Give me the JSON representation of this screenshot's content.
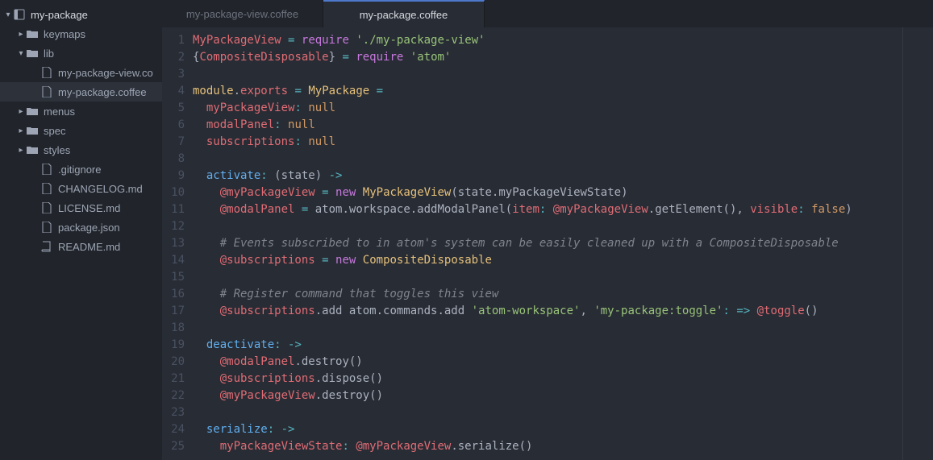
{
  "sidebar": {
    "root": "my-package",
    "items": [
      {
        "kind": "folder",
        "name": "keymaps",
        "expanded": false,
        "depth": 1
      },
      {
        "kind": "folder",
        "name": "lib",
        "expanded": true,
        "depth": 1
      },
      {
        "kind": "file",
        "name": "my-package-view.co",
        "depth": 2,
        "icon": "file"
      },
      {
        "kind": "file",
        "name": "my-package.coffee",
        "depth": 2,
        "icon": "file",
        "selected": true
      },
      {
        "kind": "folder",
        "name": "menus",
        "expanded": false,
        "depth": 1
      },
      {
        "kind": "folder",
        "name": "spec",
        "expanded": false,
        "depth": 1
      },
      {
        "kind": "folder",
        "name": "styles",
        "expanded": false,
        "depth": 1
      },
      {
        "kind": "file",
        "name": ".gitignore",
        "depth": 2,
        "icon": "file"
      },
      {
        "kind": "file",
        "name": "CHANGELOG.md",
        "depth": 2,
        "icon": "file"
      },
      {
        "kind": "file",
        "name": "LICENSE.md",
        "depth": 2,
        "icon": "file"
      },
      {
        "kind": "file",
        "name": "package.json",
        "depth": 2,
        "icon": "file"
      },
      {
        "kind": "file",
        "name": "README.md",
        "depth": 2,
        "icon": "book"
      }
    ]
  },
  "tabs": [
    {
      "label": "my-package-view.coffee",
      "active": false
    },
    {
      "label": "my-package.coffee",
      "active": true
    }
  ],
  "code_lines": [
    [
      {
        "t": "MyPackageView",
        "c": "c-red"
      },
      {
        "t": " ",
        "c": "c-def"
      },
      {
        "t": "=",
        "c": "c-cyan"
      },
      {
        "t": " ",
        "c": "c-def"
      },
      {
        "t": "require",
        "c": "c-purple"
      },
      {
        "t": " ",
        "c": "c-def"
      },
      {
        "t": "'./my-package-view'",
        "c": "c-green"
      }
    ],
    [
      {
        "t": "{",
        "c": "c-def"
      },
      {
        "t": "CompositeDisposable",
        "c": "c-red"
      },
      {
        "t": "} ",
        "c": "c-def"
      },
      {
        "t": "=",
        "c": "c-cyan"
      },
      {
        "t": " ",
        "c": "c-def"
      },
      {
        "t": "require",
        "c": "c-purple"
      },
      {
        "t": " ",
        "c": "c-def"
      },
      {
        "t": "'atom'",
        "c": "c-green"
      }
    ],
    [],
    [
      {
        "t": "module",
        "c": "c-yellow"
      },
      {
        "t": ".",
        "c": "c-def"
      },
      {
        "t": "exports",
        "c": "c-red"
      },
      {
        "t": " ",
        "c": "c-def"
      },
      {
        "t": "=",
        "c": "c-cyan"
      },
      {
        "t": " ",
        "c": "c-def"
      },
      {
        "t": "MyPackage",
        "c": "c-yellow"
      },
      {
        "t": " ",
        "c": "c-def"
      },
      {
        "t": "=",
        "c": "c-cyan"
      }
    ],
    [
      {
        "t": "  ",
        "c": "c-def"
      },
      {
        "t": "myPackageView",
        "c": "c-red"
      },
      {
        "t": ":",
        "c": "c-cyan"
      },
      {
        "t": " ",
        "c": "c-def"
      },
      {
        "t": "null",
        "c": "c-orange"
      }
    ],
    [
      {
        "t": "  ",
        "c": "c-def"
      },
      {
        "t": "modalPanel",
        "c": "c-red"
      },
      {
        "t": ":",
        "c": "c-cyan"
      },
      {
        "t": " ",
        "c": "c-def"
      },
      {
        "t": "null",
        "c": "c-orange"
      }
    ],
    [
      {
        "t": "  ",
        "c": "c-def"
      },
      {
        "t": "subscriptions",
        "c": "c-red"
      },
      {
        "t": ":",
        "c": "c-cyan"
      },
      {
        "t": " ",
        "c": "c-def"
      },
      {
        "t": "null",
        "c": "c-orange"
      }
    ],
    [],
    [
      {
        "t": "  ",
        "c": "c-def"
      },
      {
        "t": "activate",
        "c": "c-blue"
      },
      {
        "t": ":",
        "c": "c-cyan"
      },
      {
        "t": " (",
        "c": "c-def"
      },
      {
        "t": "state",
        "c": "c-def"
      },
      {
        "t": ") ",
        "c": "c-def"
      },
      {
        "t": "->",
        "c": "c-cyan"
      }
    ],
    [
      {
        "t": "    ",
        "c": "c-def"
      },
      {
        "t": "@myPackageView",
        "c": "c-red"
      },
      {
        "t": " ",
        "c": "c-def"
      },
      {
        "t": "=",
        "c": "c-cyan"
      },
      {
        "t": " ",
        "c": "c-def"
      },
      {
        "t": "new",
        "c": "c-purple"
      },
      {
        "t": " ",
        "c": "c-def"
      },
      {
        "t": "MyPackageView",
        "c": "c-yellow"
      },
      {
        "t": "(state.myPackageViewState)",
        "c": "c-def"
      }
    ],
    [
      {
        "t": "    ",
        "c": "c-def"
      },
      {
        "t": "@modalPanel",
        "c": "c-red"
      },
      {
        "t": " ",
        "c": "c-def"
      },
      {
        "t": "=",
        "c": "c-cyan"
      },
      {
        "t": " atom.workspace.addModalPanel(",
        "c": "c-def"
      },
      {
        "t": "item",
        "c": "c-red"
      },
      {
        "t": ":",
        "c": "c-cyan"
      },
      {
        "t": " ",
        "c": "c-def"
      },
      {
        "t": "@myPackageView",
        "c": "c-red"
      },
      {
        "t": ".getElement(), ",
        "c": "c-def"
      },
      {
        "t": "visible",
        "c": "c-red"
      },
      {
        "t": ":",
        "c": "c-cyan"
      },
      {
        "t": " ",
        "c": "c-def"
      },
      {
        "t": "false",
        "c": "c-orange"
      },
      {
        "t": ")",
        "c": "c-def"
      }
    ],
    [],
    [
      {
        "t": "    ",
        "c": "c-def"
      },
      {
        "t": "# Events subscribed to in atom's system can be easily cleaned up with a CompositeDisposable",
        "c": "c-grey"
      }
    ],
    [
      {
        "t": "    ",
        "c": "c-def"
      },
      {
        "t": "@subscriptions",
        "c": "c-red"
      },
      {
        "t": " ",
        "c": "c-def"
      },
      {
        "t": "=",
        "c": "c-cyan"
      },
      {
        "t": " ",
        "c": "c-def"
      },
      {
        "t": "new",
        "c": "c-purple"
      },
      {
        "t": " ",
        "c": "c-def"
      },
      {
        "t": "CompositeDisposable",
        "c": "c-yellow"
      }
    ],
    [],
    [
      {
        "t": "    ",
        "c": "c-def"
      },
      {
        "t": "# Register command that toggles this view",
        "c": "c-grey"
      }
    ],
    [
      {
        "t": "    ",
        "c": "c-def"
      },
      {
        "t": "@subscriptions",
        "c": "c-red"
      },
      {
        "t": ".add atom.commands.add ",
        "c": "c-def"
      },
      {
        "t": "'atom-workspace'",
        "c": "c-green"
      },
      {
        "t": ", ",
        "c": "c-def"
      },
      {
        "t": "'my-package:toggle'",
        "c": "c-green"
      },
      {
        "t": ":",
        "c": "c-cyan"
      },
      {
        "t": " ",
        "c": "c-def"
      },
      {
        "t": "=>",
        "c": "c-cyan"
      },
      {
        "t": " ",
        "c": "c-def"
      },
      {
        "t": "@toggle",
        "c": "c-red"
      },
      {
        "t": "()",
        "c": "c-def"
      }
    ],
    [],
    [
      {
        "t": "  ",
        "c": "c-def"
      },
      {
        "t": "deactivate",
        "c": "c-blue"
      },
      {
        "t": ":",
        "c": "c-cyan"
      },
      {
        "t": " ",
        "c": "c-def"
      },
      {
        "t": "->",
        "c": "c-cyan"
      }
    ],
    [
      {
        "t": "    ",
        "c": "c-def"
      },
      {
        "t": "@modalPanel",
        "c": "c-red"
      },
      {
        "t": ".destroy()",
        "c": "c-def"
      }
    ],
    [
      {
        "t": "    ",
        "c": "c-def"
      },
      {
        "t": "@subscriptions",
        "c": "c-red"
      },
      {
        "t": ".dispose()",
        "c": "c-def"
      }
    ],
    [
      {
        "t": "    ",
        "c": "c-def"
      },
      {
        "t": "@myPackageView",
        "c": "c-red"
      },
      {
        "t": ".destroy()",
        "c": "c-def"
      }
    ],
    [],
    [
      {
        "t": "  ",
        "c": "c-def"
      },
      {
        "t": "serialize",
        "c": "c-blue"
      },
      {
        "t": ":",
        "c": "c-cyan"
      },
      {
        "t": " ",
        "c": "c-def"
      },
      {
        "t": "->",
        "c": "c-cyan"
      }
    ],
    [
      {
        "t": "    ",
        "c": "c-def"
      },
      {
        "t": "myPackageViewState",
        "c": "c-red"
      },
      {
        "t": ":",
        "c": "c-cyan"
      },
      {
        "t": " ",
        "c": "c-def"
      },
      {
        "t": "@myPackageView",
        "c": "c-red"
      },
      {
        "t": ".serialize()",
        "c": "c-def"
      }
    ]
  ]
}
